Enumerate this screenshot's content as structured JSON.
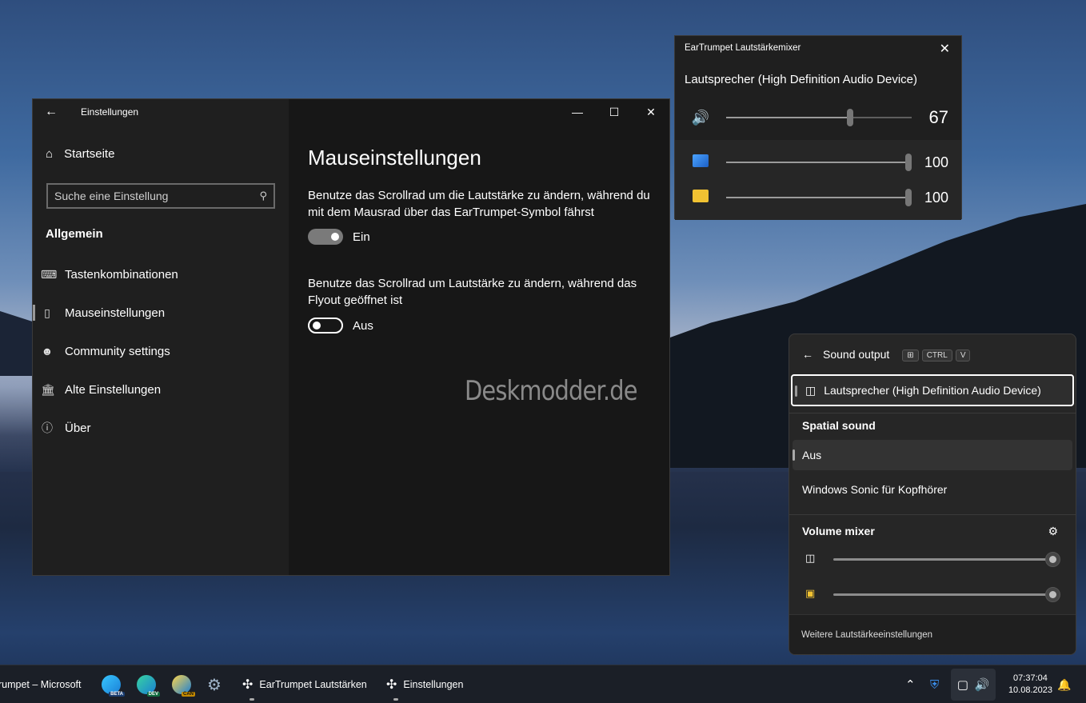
{
  "colors": {
    "accent": "#ffffff",
    "window_bg": "#1f1f1f",
    "content_bg": "#171717"
  },
  "settings_window": {
    "title": "Einstellungen",
    "nav_home": "Startseite",
    "search_placeholder": "Suche eine Einstellung",
    "section": "Allgemein",
    "nav_items": [
      {
        "label": "Tastenkombinationen",
        "icon": "keyboard-icon"
      },
      {
        "label": "Mauseinstellungen",
        "icon": "mouse-icon"
      },
      {
        "label": "Community settings",
        "icon": "people-icon"
      },
      {
        "label": "Alte Einstellungen",
        "icon": "building-icon"
      },
      {
        "label": "Über",
        "icon": "info-icon"
      }
    ],
    "page_title": "Mauseinstellungen",
    "option1_text": "Benutze das Scrollrad um die Lautstärke zu ändern, während du mit dem Mausrad über das EarTrumpet-Symbol fährst",
    "option1_state": "Ein",
    "option2_text": "Benutze das Scrollrad um Lautstärke zu ändern, während das Flyout geöffnet ist",
    "option2_state": "Aus",
    "watermark": "Deskmodder.de"
  },
  "mixer": {
    "title": "EarTrumpet Lautstärkemixer",
    "device": "Lautsprecher (High Definition Audio Device)",
    "main_volume": 67,
    "main_volume_text": "67",
    "apps": [
      {
        "icon": "system-sounds-icon",
        "volume": 100,
        "volume_text": "100"
      },
      {
        "icon": "explorer-icon",
        "volume": 100,
        "volume_text": "100"
      }
    ]
  },
  "flyout": {
    "title": "Sound output",
    "keys": [
      "CTRL",
      "V"
    ],
    "device": "Lautsprecher (High Definition Audio Device)",
    "spatial_heading": "Spatial sound",
    "spatial_options": [
      "Aus",
      "Windows Sonic für Kopfhörer"
    ],
    "mixer_heading": "Volume mixer",
    "footer": "Weitere Lautstärkeeinstellungen"
  },
  "taskbar": {
    "items": [
      {
        "label": "rumpet – Microsoft"
      },
      {
        "label": "BETA"
      },
      {
        "label": "DEV"
      },
      {
        "label": "CAN"
      },
      {
        "label": "EarTrumpet Lautstärken"
      },
      {
        "label": "Einstellungen"
      }
    ],
    "time": "07:37:04",
    "date": "10.08.2023"
  }
}
